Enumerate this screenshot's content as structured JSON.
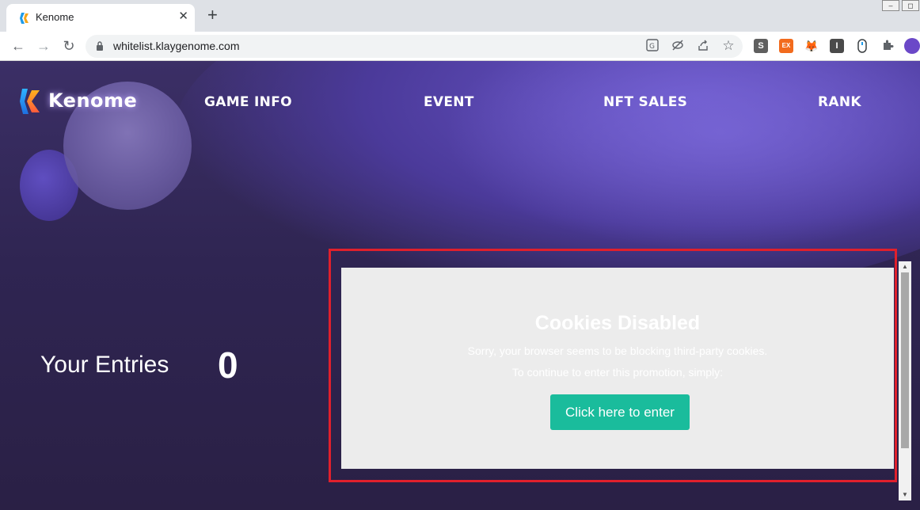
{
  "browser": {
    "tab_title": "Kenome",
    "tab_close": "✕",
    "new_tab": "+",
    "url": "whitelist.klaygenome.com",
    "back": "←",
    "forward": "→",
    "reload": "↻",
    "star": "☆",
    "extensions": [
      {
        "name": "s-extension-icon",
        "label": "S",
        "color": "#5f5f5f"
      },
      {
        "name": "ex-extension-icon",
        "label": "EX",
        "color": "#f26b1d"
      },
      {
        "name": "metamask-icon",
        "label": "🦊",
        "color": "#ffffff"
      },
      {
        "name": "i-extension-icon",
        "label": "I",
        "color": "#4a4a4a"
      }
    ]
  },
  "site": {
    "logo": "Kenome",
    "nav": [
      "GAME INFO",
      "EVENT",
      "NFT SALES",
      "RANK"
    ]
  },
  "entries": {
    "label": "Your Entries",
    "value": "0"
  },
  "widget": {
    "title": "Cookies Disabled",
    "line1": "Sorry, your browser seems to be blocking third-party cookies.",
    "line2": "To continue to enter this promotion, simply:",
    "button": "Click here to enter"
  },
  "colors": {
    "accent_button": "#1abc9c",
    "highlight_border": "#e0202c"
  }
}
